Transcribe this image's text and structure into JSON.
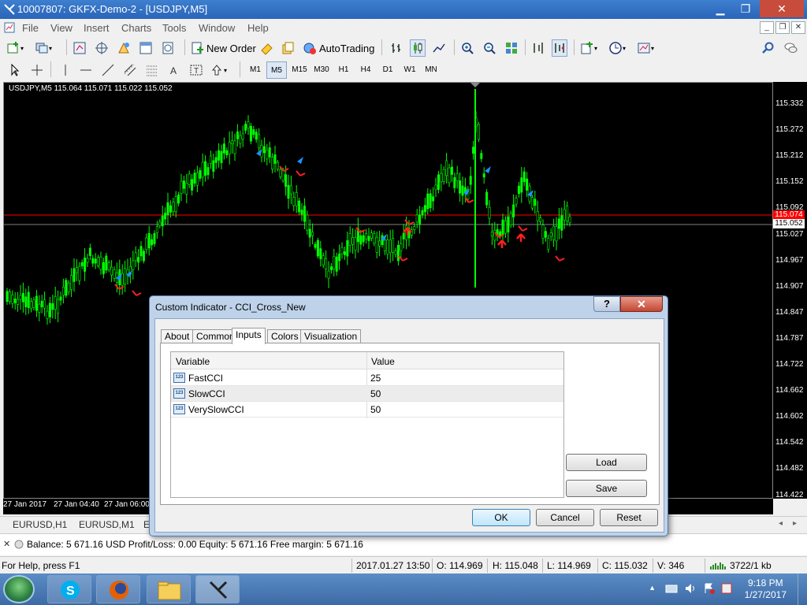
{
  "window": {
    "title": "10007807: GKFX-Demo-2 - [USDJPY,M5]",
    "minimize": "▁",
    "restore": "❐",
    "close": "✕"
  },
  "menu": [
    "File",
    "View",
    "Insert",
    "Charts",
    "Tools",
    "Window",
    "Help"
  ],
  "toolbar": {
    "new_order": "New Order",
    "auto_trading": "AutoTrading"
  },
  "timeframes": [
    "M1",
    "M5",
    "M15",
    "M30",
    "H1",
    "H4",
    "D1",
    "W1",
    "MN"
  ],
  "active_timeframe": "M5",
  "chart": {
    "header": "USDJPY,M5  115.064 115.071 115.022 115.052",
    "price_levels": [
      "115.332",
      "115.272",
      "115.212",
      "115.152",
      "115.092",
      "115.027",
      "114.967",
      "114.907",
      "114.847",
      "114.787",
      "114.722",
      "114.662",
      "114.602",
      "114.542",
      "114.482",
      "114.422"
    ],
    "ask_tag": "115.074",
    "bid_tag": "115.052",
    "time_labels": [
      "27 Jan 2017",
      "27 Jan 04:40",
      "27 Jan 06:00"
    ],
    "colors": {
      "candle": "#00ff00",
      "ask_line": "#ff0000",
      "bid_line": "#7f7f7f",
      "buy_arrow": "#1e90ff",
      "sell_arrow": "#ff2020"
    }
  },
  "chart_tabs": [
    "EURUSD,H1",
    "EURUSD,M1",
    "E"
  ],
  "terminal": {
    "text": "Balance: 5 671.16 USD  Profit/Loss: 0.00  Equity: 5 671.16  Free margin: 5 671.16"
  },
  "statusbar": {
    "help": "For Help, press F1",
    "datetime": "2017.01.27 13:50",
    "open": "O: 114.969",
    "high": "H: 115.048",
    "low": "L: 114.969",
    "close": "C: 115.032",
    "volume": "V: 346",
    "traffic": "3722/1 kb"
  },
  "taskbar": {
    "time": "9:18 PM",
    "date": "1/27/2017"
  },
  "dialog": {
    "title": "Custom Indicator - CCI_Cross_New",
    "help": "?",
    "close": "✕",
    "tabs": [
      "About",
      "Common",
      "Inputs",
      "Colors",
      "Visualization"
    ],
    "active_tab": "Inputs",
    "columns": [
      "Variable",
      "Value"
    ],
    "rows": [
      {
        "type": "123",
        "name": "FastCCI",
        "value": "25"
      },
      {
        "type": "123",
        "name": "SlowCCI",
        "value": "50"
      },
      {
        "type": "123",
        "name": "VerySlowCCI",
        "value": "50"
      }
    ],
    "load": "Load",
    "save": "Save",
    "ok": "OK",
    "cancel": "Cancel",
    "reset": "Reset"
  }
}
